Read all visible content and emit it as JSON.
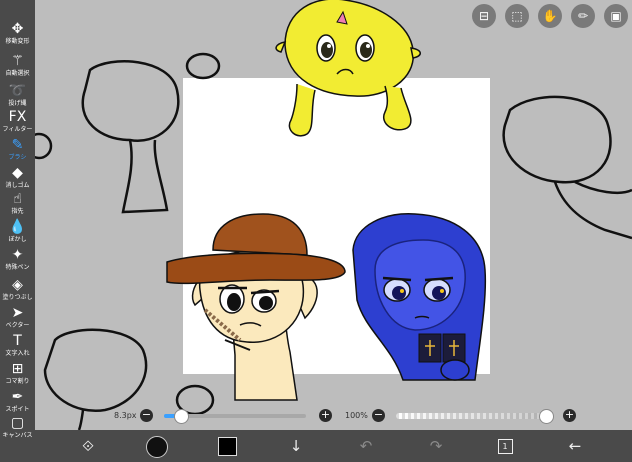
{
  "sidebar": {
    "tools": [
      {
        "label": "移動変形",
        "icon": "move-icon",
        "glyph": "✥"
      },
      {
        "label": "自動選択",
        "icon": "magic-wand-icon",
        "glyph": "⚚"
      },
      {
        "label": "投げ縄",
        "icon": "lasso-icon",
        "glyph": "➰"
      },
      {
        "label": "フィルター",
        "icon": "filter-fx-icon",
        "glyph": "FX"
      },
      {
        "label": "ブラシ",
        "icon": "brush-icon",
        "glyph": "✎",
        "active": true
      },
      {
        "label": "消しゴム",
        "icon": "eraser-icon",
        "glyph": "◆"
      },
      {
        "label": "指先",
        "icon": "finger-smudge-icon",
        "glyph": "☝"
      },
      {
        "label": "ぼかし",
        "icon": "blur-drop-icon",
        "glyph": "💧"
      },
      {
        "label": "特殊ペン",
        "icon": "special-pen-icon",
        "glyph": "✦"
      },
      {
        "label": "塗りつぶし",
        "icon": "fill-bucket-icon",
        "glyph": "◈"
      },
      {
        "label": "ベクター",
        "icon": "vector-cursor-icon",
        "glyph": "➤"
      },
      {
        "label": "文字入れ",
        "icon": "text-icon",
        "glyph": "T"
      },
      {
        "label": "コマ割り",
        "icon": "frame-divider-icon",
        "glyph": "⊞"
      },
      {
        "label": "スポイト",
        "icon": "eyedropper-icon",
        "glyph": "✒"
      },
      {
        "label": "キャンバス",
        "icon": "canvas-icon",
        "glyph": "▢"
      }
    ]
  },
  "top_icons": [
    "toggle-icon",
    "selection-icon",
    "hand-icon",
    "ruler-icon",
    "image-icon"
  ],
  "sliders": {
    "brush_size": "8.3px",
    "brush_size_fraction": 0.12,
    "opacity": "100%",
    "opacity_fraction": 1.0
  },
  "bottom_bar": {
    "color_swatch": "#000000",
    "layer_count": "1"
  },
  "colors": {
    "toolbar": "#4a4a4a",
    "accent": "#3aa0ff",
    "hat": "#a0521d",
    "yellow_char": "#f2ec32",
    "blue_char": "#2d3fd0",
    "skin": "#fbe9bd"
  }
}
